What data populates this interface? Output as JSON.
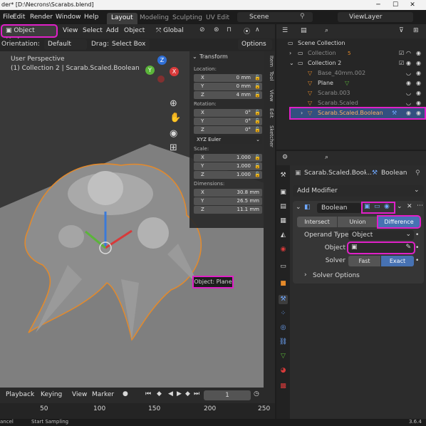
{
  "titlebar": {
    "title": "der* [D:\\Necrons\\Scarabs.blend]",
    "minimize": "─",
    "maximize": "☐",
    "close": "✕"
  },
  "menubar": {
    "items": [
      "File",
      "Edit",
      "Render",
      "Window",
      "Help"
    ],
    "workspaces": [
      "Layout",
      "Modeling",
      "Sculpting",
      "UV Edit"
    ],
    "scene": "Scene",
    "view_layer": "ViewLayer"
  },
  "viewport_header": {
    "mode": "Object Mode",
    "menus": [
      "View",
      "Select",
      "Add",
      "Object"
    ],
    "transform_orientation": "Global"
  },
  "tool_settings": {
    "orientation_label": "Orientation:",
    "orientation_value": "Default",
    "drag_label": "Drag:",
    "drag_value": "Select Box",
    "options": "Options"
  },
  "viewport": {
    "perspective": "User Perspective",
    "info": "(1) Collection 2 | Scarab.Scaled.Boolean",
    "tooltip": "Object: Plane",
    "gizmo": {
      "x": "X",
      "y": "Y",
      "z": "Z"
    }
  },
  "npanel": {
    "title": "Transform",
    "location_label": "Location:",
    "location": {
      "x": "0 mm",
      "y": "0 mm",
      "z": "4 mm"
    },
    "rotation_label": "Rotation:",
    "rotation": {
      "x": "0°",
      "y": "0°",
      "z": "0°"
    },
    "rotation_mode": "XYZ Euler",
    "scale_label": "Scale:",
    "scale": {
      "x": "1.000",
      "y": "1.000",
      "z": "1.000"
    },
    "dimensions_label": "Dimensions:",
    "dimensions": {
      "x": "30.8 mm",
      "y": "26.5 mm",
      "z": "11.1 mm"
    },
    "axis": {
      "x": "X",
      "y": "Y",
      "z": "Z"
    }
  },
  "sidetabs": [
    "Item",
    "Tool",
    "View",
    "Edit",
    "Sketcher"
  ],
  "timeline": {
    "menus": [
      "Playback",
      "Keying",
      "View",
      "Marker"
    ],
    "current_frame": "1",
    "ruler": [
      "50",
      "100",
      "150",
      "200",
      "250"
    ]
  },
  "statusbar": {
    "left": "ancel",
    "sampling": "Start Sampling",
    "version": "3.6.4"
  },
  "outliner": {
    "rows": [
      {
        "name": "Scene Collection",
        "indent": 0
      },
      {
        "name": "Collection",
        "indent": 1,
        "badge": "5",
        "dim": true
      },
      {
        "name": "Collection 2",
        "indent": 1
      },
      {
        "name": "Base_40mm.002",
        "indent": 2,
        "dim": true
      },
      {
        "name": "Plane",
        "indent": 2
      },
      {
        "name": "Scarab.003",
        "indent": 2,
        "dim": true
      },
      {
        "name": "Scarab.Scaled",
        "indent": 2,
        "dim": true
      },
      {
        "name": "Scarab.Scaled.Boolean",
        "indent": 2,
        "selected": true
      }
    ]
  },
  "properties": {
    "breadcrumb_object": "Scarab.Scaled.Bool...",
    "breadcrumb_modifier": "Boolean",
    "add_modifier": "Add Modifier",
    "modifier_name": "Boolean",
    "operations": [
      "Intersect",
      "Union",
      "Difference"
    ],
    "active_operation": "Difference",
    "operand_type_label": "Operand Type",
    "operand_type": "Object",
    "object_label": "Object",
    "object_value": "",
    "solver_label": "Solver",
    "solvers": [
      "Fast",
      "Exact"
    ],
    "active_solver": "Exact",
    "solver_options": "Solver Options"
  },
  "colors": {
    "accent": "#4772b3",
    "highlight": "#e020c8",
    "selection": "#e58a2a"
  }
}
